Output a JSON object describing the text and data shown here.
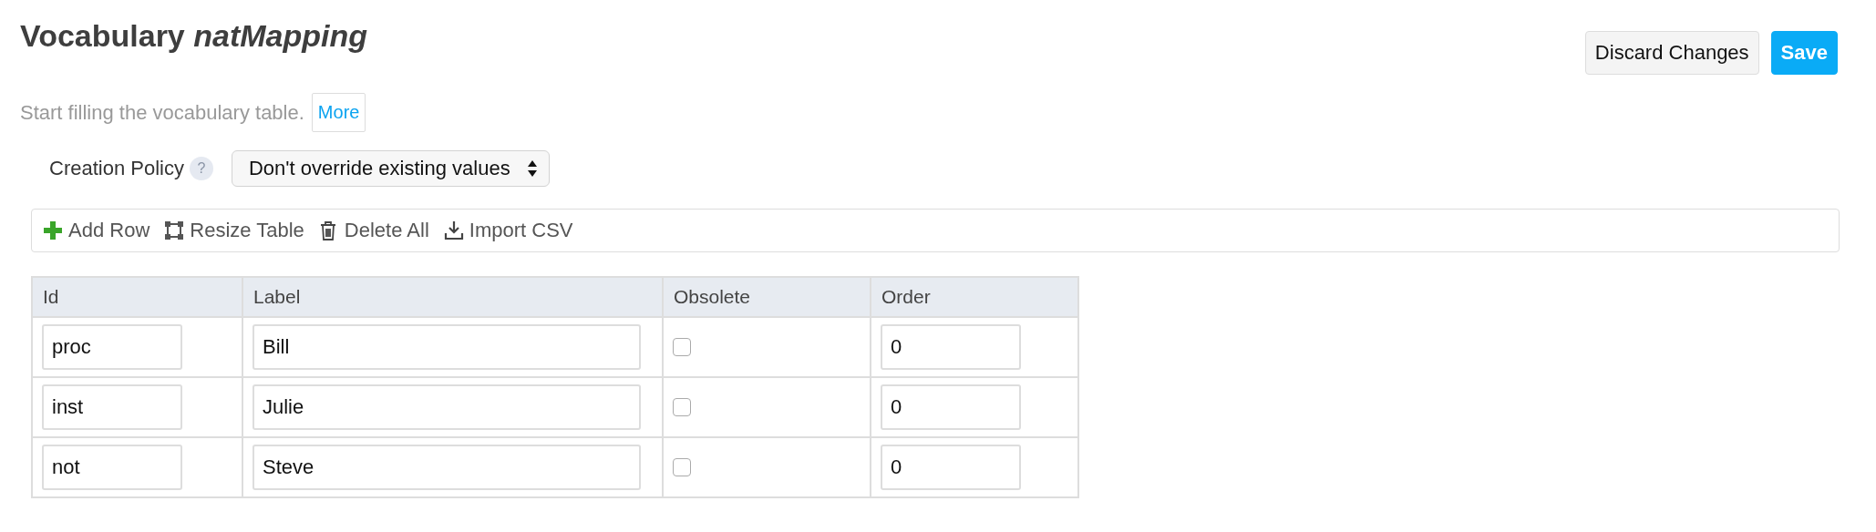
{
  "title": {
    "prefix": "Vocabulary",
    "name": "natMapping"
  },
  "description": "Start filling the vocabulary table.",
  "more_button": "More",
  "buttons": [
    {
      "label": "Discard Changes",
      "kind": "default"
    },
    {
      "label": "Save",
      "kind": "primary"
    }
  ],
  "creation_policy": {
    "label": "Creation Policy",
    "help": "?",
    "value": "Don't override existing values"
  },
  "toolbar": [
    {
      "label": "Add Row",
      "kind": "add"
    },
    {
      "label": "Resize Table",
      "kind": "resize"
    },
    {
      "label": "Delete All",
      "kind": "delete"
    },
    {
      "label": "Import CSV",
      "kind": "import"
    }
  ],
  "table": {
    "columns": [
      "Id",
      "Label",
      "Obsolete",
      "Order"
    ],
    "rows": [
      {
        "id": "proc",
        "label": "Bill",
        "obsolete": false,
        "order": "0"
      },
      {
        "id": "inst",
        "label": "Julie",
        "obsolete": false,
        "order": "0"
      },
      {
        "id": "not",
        "label": "Steve",
        "obsolete": false,
        "order": "0"
      }
    ]
  }
}
